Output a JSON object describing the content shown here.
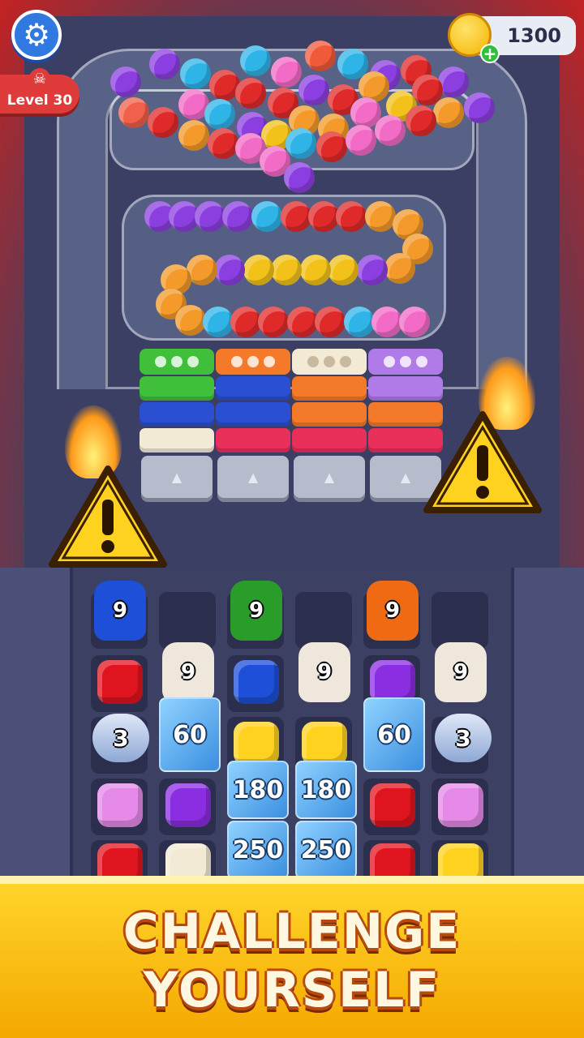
{
  "hud": {
    "settings_icon": "gear-icon",
    "level_label": "Level 30",
    "level_icon": "skull-icon",
    "coins": "1300",
    "coin_icon": "coin-icon",
    "add_coins_icon": "plus-icon"
  },
  "warnings": {
    "icon": "warning-icon"
  },
  "board": {
    "pot_values": [
      "9",
      "9",
      "9",
      "9",
      "9",
      "9"
    ],
    "capsule_values": [
      "3",
      "3"
    ],
    "ice_values": [
      "60",
      "60",
      "180",
      "180",
      "250",
      "250"
    ]
  },
  "banner": {
    "line1": "CHALLENGE",
    "line2": "YOURSELF"
  },
  "colors": {
    "accent": "#2f79e0",
    "danger": "#e03b3b",
    "banner": "#f4b400"
  }
}
